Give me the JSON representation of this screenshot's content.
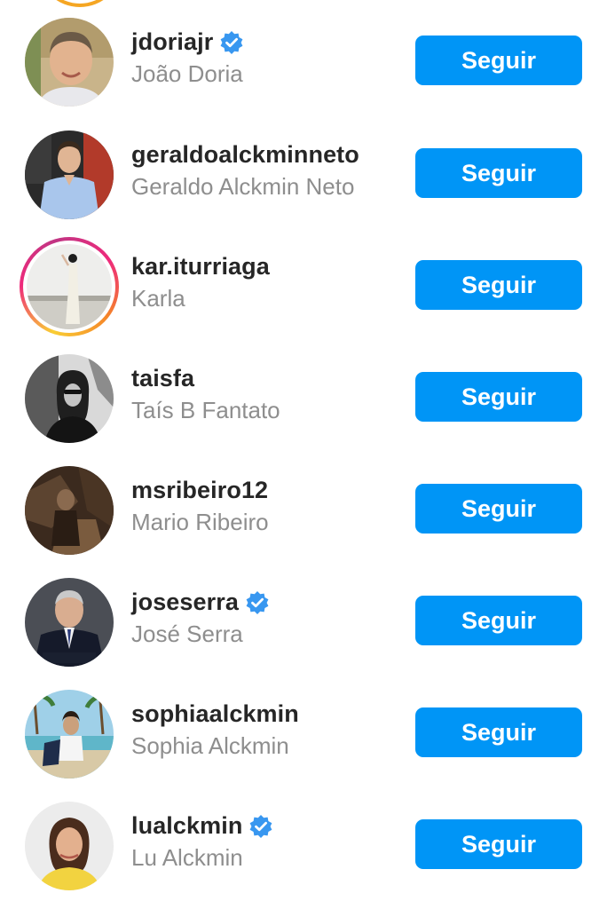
{
  "accounts": [
    {
      "username": "jdoriajr",
      "full_name": "João Doria",
      "verified": true,
      "button_label": "Seguir"
    },
    {
      "username": "geraldoalckminneto",
      "full_name": "Geraldo Alckmin Neto",
      "verified": false,
      "button_label": "Seguir"
    },
    {
      "username": "kar.iturriaga",
      "full_name": "Karla",
      "verified": false,
      "story_ring": true,
      "button_label": "Seguir"
    },
    {
      "username": "taisfa",
      "full_name": "Taís B Fantato",
      "verified": false,
      "button_label": "Seguir"
    },
    {
      "username": "msribeiro12",
      "full_name": "Mario Ribeiro",
      "verified": false,
      "button_label": "Seguir"
    },
    {
      "username": "joseserra",
      "full_name": "José Serra",
      "verified": true,
      "button_label": "Seguir"
    },
    {
      "username": "sophiaalckmin",
      "full_name": "Sophia Alckmin",
      "verified": false,
      "button_label": "Seguir"
    },
    {
      "username": "lualckmin",
      "full_name": "Lu Alckmin",
      "verified": true,
      "button_label": "Seguir"
    }
  ],
  "colors": {
    "button_bg": "#0095f6",
    "button_text": "#ffffff",
    "username": "#262626",
    "full_name": "#8e8e8e",
    "verified_badge": "#3897f0"
  },
  "icons": {
    "verified": "verified-badge-icon"
  }
}
